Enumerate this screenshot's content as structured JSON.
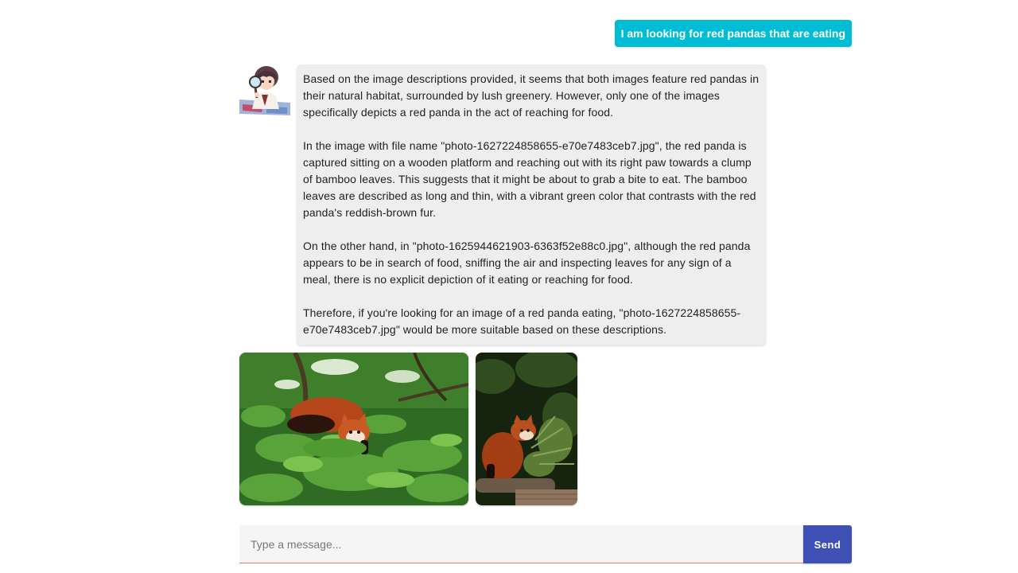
{
  "user_message": {
    "text": "I am looking for red pandas that are eating"
  },
  "assistant_message": {
    "avatar_icon": "detective-avatar-icon",
    "paragraphs": [
      "Based on the image descriptions provided, it seems that both images feature red pandas in their natural habitat, surrounded by lush greenery. However, only one of the images specifically depicts a red panda in the act of reaching for food.",
      "In the image with file name \"photo-1627224858655-e70e7483ceb7.jpg\", the red panda is captured sitting on a wooden platform and reaching out with its right paw towards a clump of bamboo leaves. This suggests that it might be about to grab a bite to eat. The bamboo leaves are described as long and thin, with a vibrant green color that contrasts with the red panda's reddish-brown fur.",
      "On the other hand, in \"photo-1625944621903-6363f52e88c0.jpg\", although the red panda appears to be in search of food, sniffing the air and inspecting leaves for any sign of a meal, there is no explicit depiction of it eating or reaching for food.",
      "Therefore, if you're looking for an image of a red panda eating, \"photo-1627224858655-e70e7483ceb7.jpg\" would be more suitable based on these descriptions."
    ]
  },
  "images": [
    {
      "name": "red-panda-in-tree-photo"
    },
    {
      "name": "red-panda-on-log-photo"
    }
  ],
  "composer": {
    "placeholder": "Type a message...",
    "value": "",
    "send_label": "Send"
  },
  "colors": {
    "user_bubble": "#00bcd4",
    "assistant_bubble": "#eeeeee",
    "send_button": "#3f51b5",
    "input_underline": "#e57373"
  }
}
